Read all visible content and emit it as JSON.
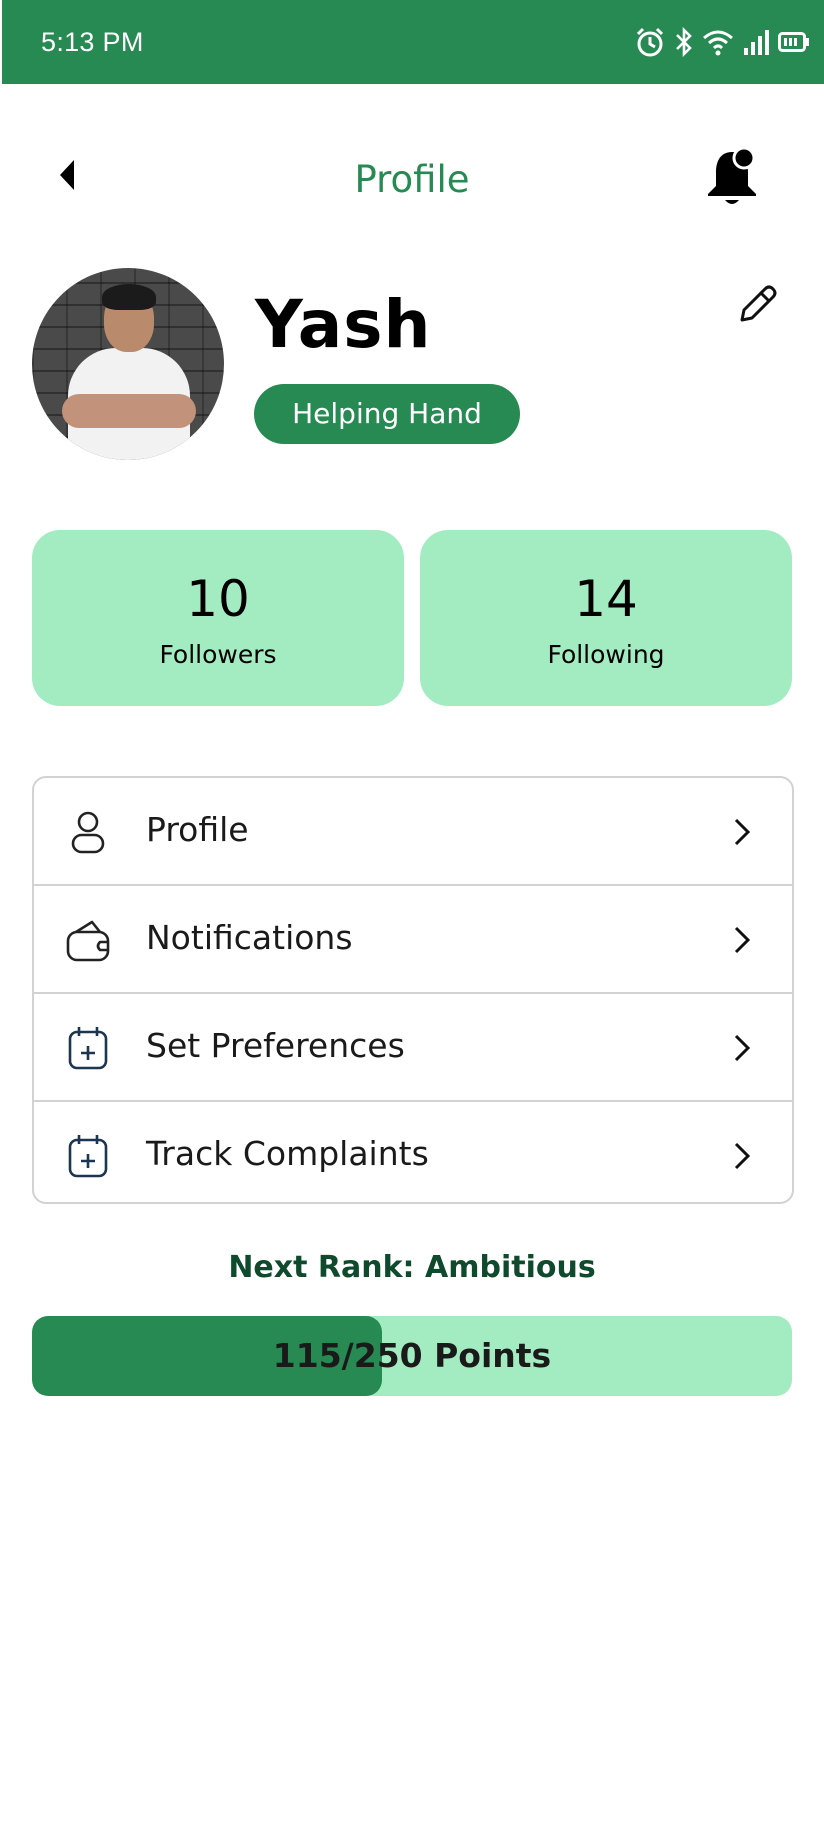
{
  "status_bar": {
    "time": "5:13 PM",
    "icons": [
      "alarm-icon",
      "bluetooth-icon",
      "wifi-icon",
      "signal-icon",
      "battery-icon"
    ]
  },
  "header": {
    "title": "Profile",
    "back_icon": "back-arrow-icon",
    "bell_icon": "notification-bell-icon"
  },
  "profile": {
    "name": "Yash",
    "rank": "Helping Hand",
    "edit_icon": "pencil-icon"
  },
  "stats": {
    "followers": {
      "value": "10",
      "label": "Followers"
    },
    "following": {
      "value": "14",
      "label": "Following"
    }
  },
  "menu": {
    "items": [
      {
        "label": "Profile",
        "icon": "user-icon"
      },
      {
        "label": "Notifications",
        "icon": "wallet-icon"
      },
      {
        "label": "Set Preferences",
        "icon": "calendar-plus-icon"
      },
      {
        "label": "Track Complaints",
        "icon": "calendar-plus-icon"
      }
    ]
  },
  "progress": {
    "next_rank_label": "Next Rank: Ambitious",
    "points_text": "115/250 Points",
    "current": 115,
    "target": 250
  },
  "colors": {
    "primary": "#268a52",
    "light_green": "#a3ecc2",
    "dark_green_text": "#0f4a2c"
  }
}
